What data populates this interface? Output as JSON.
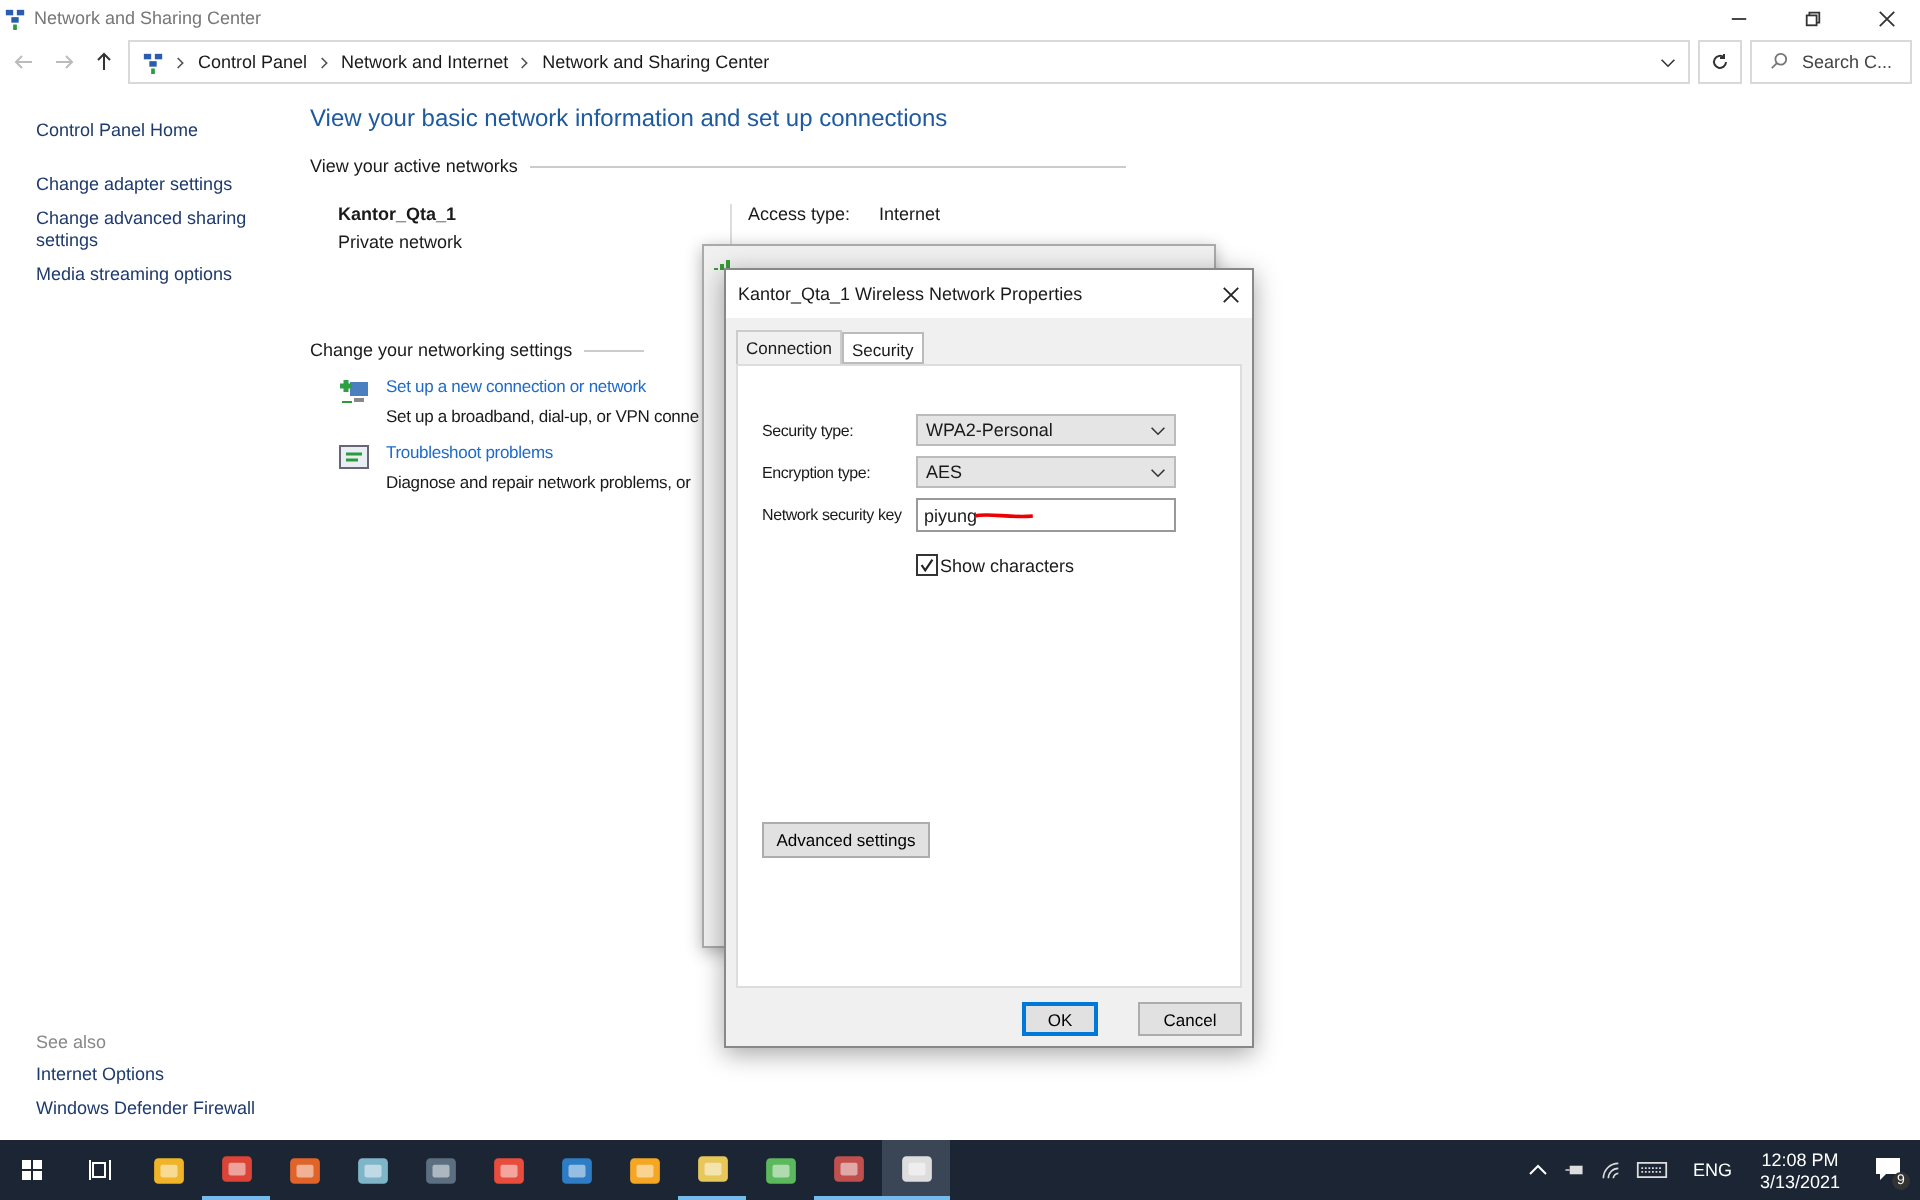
{
  "window": {
    "title": "Network and Sharing Center",
    "breadcrumb": [
      "Control Panel",
      "Network and Internet",
      "Network and Sharing Center"
    ],
    "search": {
      "placeholder": "Search C..."
    }
  },
  "sidebar": {
    "links": [
      "Control Panel Home",
      "Change adapter settings",
      "Change advanced sharing settings",
      "Media streaming options"
    ],
    "see_also_title": "See also",
    "see_also": [
      "Internet Options",
      "Windows Defender Firewall"
    ]
  },
  "main": {
    "heading": "View your basic network information and set up connections",
    "active_title": "View your active networks",
    "network": {
      "name": "Kantor_Qta_1",
      "type": "Private network",
      "access_label": "Access type:",
      "access_value": "Internet"
    },
    "settings_title": "Change your networking settings",
    "actions": [
      {
        "kind": "setup",
        "link": "Set up a new connection or network",
        "description": "Set up a broadband, dial-up, or VPN conne"
      },
      {
        "kind": "troubleshoot",
        "link": "Troubleshoot problems",
        "description": "Diagnose and repair network problems, or"
      }
    ]
  },
  "dialog": {
    "title": "Kantor_Qta_1 Wireless Network Properties",
    "tabs": [
      {
        "label": "Connection",
        "selected": false
      },
      {
        "label": "Security",
        "selected": true
      }
    ],
    "fields": [
      {
        "kind": "select",
        "label": "Security type:",
        "value": "WPA2-Personal"
      },
      {
        "kind": "select",
        "label": "Encryption type:",
        "value": "AES"
      },
      {
        "kind": "text",
        "label": "Network security key",
        "value": "piyung",
        "redacted": true
      }
    ],
    "show_characters": {
      "label": "Show characters",
      "checked": true
    },
    "advanced_button": "Advanced settings",
    "buttons": [
      "OK",
      "Cancel"
    ]
  },
  "taskbar": {
    "apps": [
      {
        "running": false
      },
      {
        "running": true
      },
      {
        "running": false
      },
      {
        "running": false
      },
      {
        "running": false
      },
      {
        "running": false
      },
      {
        "running": false
      },
      {
        "running": false
      },
      {
        "running": true
      },
      {
        "running": false
      },
      {
        "running": true
      },
      {
        "running": true
      }
    ],
    "language": "ENG",
    "time": "12:08 PM",
    "date": "3/13/2021",
    "notifications": "9"
  }
}
